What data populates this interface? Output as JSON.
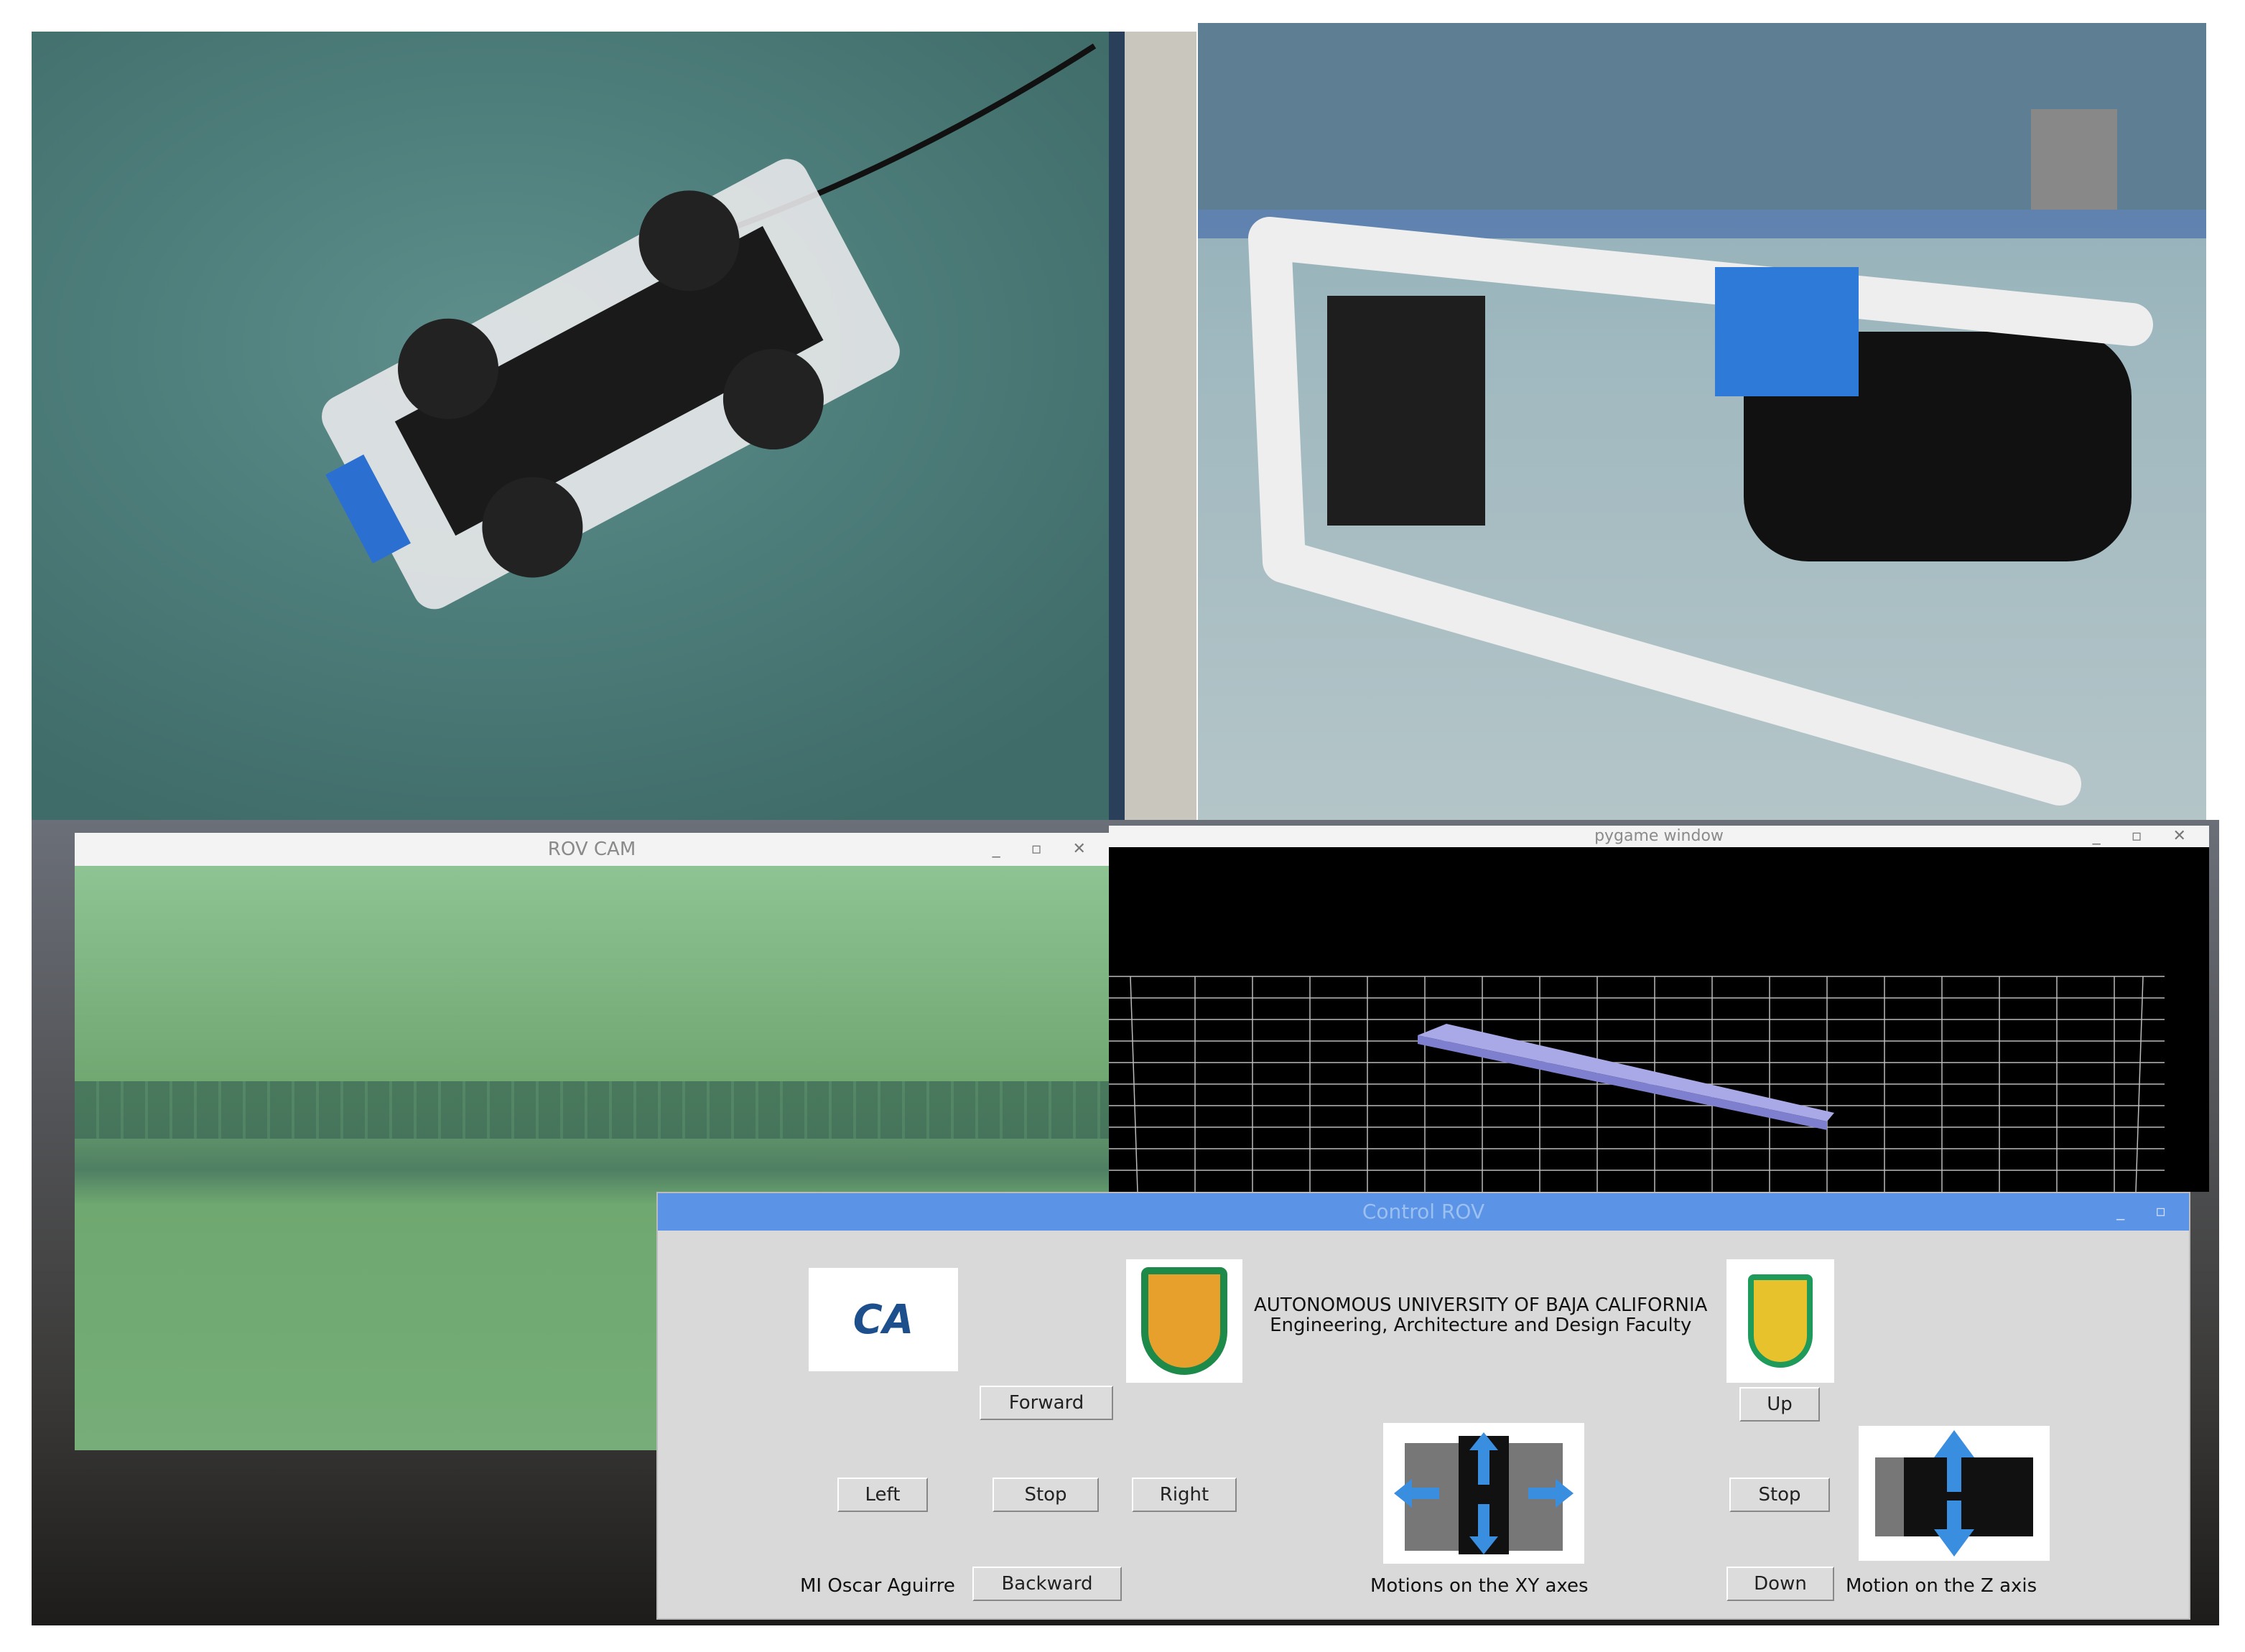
{
  "photos": {
    "top_left": "ROV on pool surface",
    "top_right": "ROV underwater"
  },
  "rov_cam": {
    "title": "ROV CAM"
  },
  "pygame": {
    "title": "pygame window"
  },
  "control": {
    "title": "Control ROV",
    "university": "AUTONOMOUS UNIVERSITY OF BAJA CALIFORNIA",
    "faculty": "Engineering, Architecture and Design Faculty",
    "ca_logo": "CA",
    "buttons": {
      "forward": "Forward",
      "left": "Left",
      "stop": "Stop",
      "right": "Right",
      "backward": "Backward",
      "up": "Up",
      "stop_z": "Stop",
      "down": "Down"
    },
    "author": "MI Oscar Aguirre",
    "xy_caption": "Motions on the XY axes",
    "z_caption": "Motion on the  Z axis"
  },
  "colors": {
    "titlebar": "#5b93e6",
    "panel": "#d9d9d9"
  }
}
